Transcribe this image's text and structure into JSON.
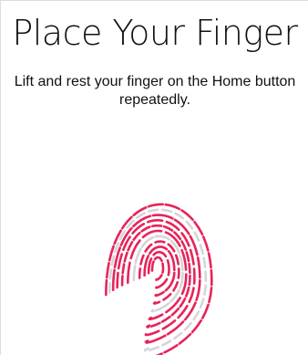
{
  "screen": {
    "title": "Place Your Finger",
    "instructions_line1": "Lift and rest your finger on the Home button",
    "instructions_line2": "repeatedly."
  },
  "fingerprint": {
    "icon": "fingerprint-icon",
    "captured_color": "#e6245a",
    "pending_color": "#d3d6da"
  }
}
